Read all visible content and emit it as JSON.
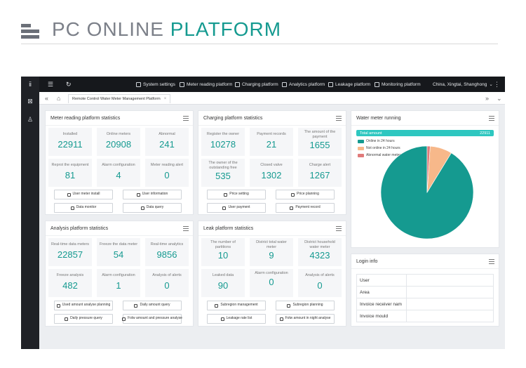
{
  "banner": {
    "title_part1": "PC ONLINE",
    "title_part2": "PLATFORM"
  },
  "colors": {
    "accent": "#159a90",
    "topbar": "#16181c",
    "total_bar": "#2ec7c0",
    "online": "#159a90",
    "not_online": "#f7b88a",
    "abnormal": "#e07a7a"
  },
  "sidebar": {
    "items": [
      {
        "icon": "logo-icon",
        "glyph": "ⅱ"
      },
      {
        "icon": "grid-icon",
        "glyph": "⊠"
      },
      {
        "icon": "user-icon",
        "glyph": "♙"
      }
    ]
  },
  "topbar": {
    "menu_glyph": "☰",
    "refresh_glyph": "↻",
    "nav": [
      {
        "label": "System settings",
        "icon": "gear-icon"
      },
      {
        "label": "Meter reading platform",
        "icon": "cube-icon"
      },
      {
        "label": "Charging platform",
        "icon": "phone-icon"
      },
      {
        "label": "Analytics platform",
        "icon": "shield-icon"
      },
      {
        "label": "Leakage platform",
        "icon": "star-icon"
      },
      {
        "label": "Monitoring platform",
        "icon": "monitor-icon"
      }
    ],
    "location": "China, Xingtai, Shanghong",
    "caret": "⌄",
    "more": "⋮"
  },
  "tabbar": {
    "back": "«",
    "home": "⌂",
    "tab_label": "Remote Control Water Meter Management Platform",
    "tab_close": "×",
    "forward": "»",
    "dropdown": "⌄"
  },
  "meter_reading": {
    "title": "Meter reading platform statistics",
    "stats": [
      {
        "label": "Installed",
        "value": "22911"
      },
      {
        "label": "Online meters",
        "value": "20908"
      },
      {
        "label": "Abnormal",
        "value": "241"
      },
      {
        "label": "Reprot the equipment",
        "value": "81"
      },
      {
        "label": "Alarm configuration",
        "value": "4"
      },
      {
        "label": "Meter reading alert",
        "value": "0"
      }
    ],
    "buttons": [
      "User meter install",
      "User information",
      "Data monitor",
      "Data query"
    ]
  },
  "charging": {
    "title": "Charging platform statistics",
    "stats": [
      {
        "label": "Register the owner",
        "value": "10278"
      },
      {
        "label": "Payment records",
        "value": "21"
      },
      {
        "label": "The amount of the payment",
        "value": "1655"
      },
      {
        "label": "The owner of the outstanding free",
        "value": "535"
      },
      {
        "label": "Closed valve",
        "value": "1302"
      },
      {
        "label": "Charge alert",
        "value": "1267"
      }
    ],
    "buttons": [
      "Price setting",
      "Price planning",
      "User payment",
      "Payment record"
    ]
  },
  "analysis": {
    "title": "Analysis platform statistics",
    "stats": [
      {
        "label": "Real-time data meters",
        "value": "22857"
      },
      {
        "label": "Freeze the data meter",
        "value": "54"
      },
      {
        "label": "Real-time analytics",
        "value": "9856"
      },
      {
        "label": "Freeze analysis",
        "value": "482"
      },
      {
        "label": "Alarm configuration",
        "value": "1"
      },
      {
        "label": "Analysis of alerts",
        "value": "0"
      }
    ],
    "buttons": [
      "Used amount analyse planning",
      "Daily amount query",
      "Daily pressure query",
      "Folw amount and pressure analyse"
    ]
  },
  "leak": {
    "title": "Leak platform statistics",
    "stats": [
      {
        "label": "The number of partitions",
        "value": "10"
      },
      {
        "label": "District total water meter",
        "value": "9"
      },
      {
        "label": "District household water meter",
        "value": "4323"
      },
      {
        "label": "Leaked data",
        "value": "90"
      },
      {
        "label": "Alarm configuration",
        "value": "0"
      },
      {
        "label": "Analysis of alerts",
        "value": "0"
      }
    ],
    "buttons": [
      "Subregion management",
      "Subregion planning",
      "Leakage rate list",
      "Folw amount in night analyse"
    ]
  },
  "water_meter": {
    "title": "Water meter running",
    "total_label": "Total amount",
    "total_value": "22911",
    "legend": [
      "Online in 24 hours",
      "Not online in 24 hours",
      "Abnormal water meter"
    ]
  },
  "chart_data": {
    "type": "pie",
    "title": "",
    "categories": [
      "Online in 24 hours",
      "Not online in 24 hours",
      "Abnormal water meter"
    ],
    "values": [
      20908,
      1762,
      241
    ]
  },
  "login_info": {
    "title": "Login info",
    "rows": [
      {
        "label": "User",
        "value": ""
      },
      {
        "label": "Area",
        "value": ""
      },
      {
        "label": "Invoice receiver nam",
        "value": ""
      },
      {
        "label": "Invoice mould",
        "value": ""
      }
    ]
  }
}
